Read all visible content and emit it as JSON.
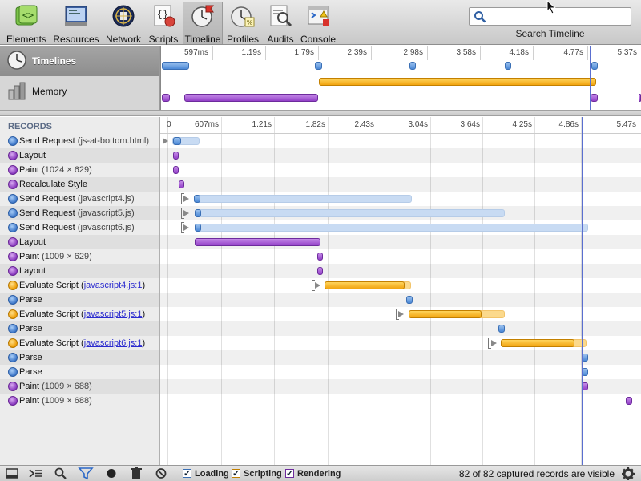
{
  "toolbar": {
    "tabs": [
      {
        "label": "Elements",
        "icon": "elements-icon"
      },
      {
        "label": "Resources",
        "icon": "resources-icon"
      },
      {
        "label": "Network",
        "icon": "network-icon"
      },
      {
        "label": "Scripts",
        "icon": "scripts-icon"
      },
      {
        "label": "Timeline",
        "icon": "timeline-icon",
        "active": true
      },
      {
        "label": "Profiles",
        "icon": "profiles-icon"
      },
      {
        "label": "Audits",
        "icon": "audits-icon"
      },
      {
        "label": "Console",
        "icon": "console-icon"
      }
    ],
    "search": {
      "value": "",
      "label": "Search Timeline"
    }
  },
  "overview": {
    "items": [
      {
        "label": "Timelines",
        "icon": "timelines-icon",
        "selected": true
      },
      {
        "label": "Memory",
        "icon": "memory-icon",
        "selected": false
      }
    ],
    "ticks": [
      "597ms",
      "1.19s",
      "1.79s",
      "2.39s",
      "2.98s",
      "3.58s",
      "4.18s",
      "4.77s",
      "5.37s"
    ]
  },
  "records": {
    "header": "RECORDS",
    "ticks": [
      "0",
      "607ms",
      "1.21s",
      "1.82s",
      "2.43s",
      "3.04s",
      "3.64s",
      "4.25s",
      "4.86s",
      "5.47s"
    ],
    "rows": [
      {
        "type": "blue",
        "name": "Send Request",
        "detail": "(js-at-bottom.html)"
      },
      {
        "type": "purple",
        "name": "Layout"
      },
      {
        "type": "purple",
        "name": "Paint",
        "detail": "(1024 × 629)"
      },
      {
        "type": "purple",
        "name": "Recalculate Style"
      },
      {
        "type": "blue",
        "name": "Send Request",
        "detail": "(javascript4.js)"
      },
      {
        "type": "blue",
        "name": "Send Request",
        "detail": "(javascript5.js)"
      },
      {
        "type": "blue",
        "name": "Send Request",
        "detail": "(javascript6.js)"
      },
      {
        "type": "purple",
        "name": "Layout"
      },
      {
        "type": "purple",
        "name": "Paint",
        "detail": "(1009 × 629)"
      },
      {
        "type": "purple",
        "name": "Layout"
      },
      {
        "type": "orange",
        "name": "Evaluate Script",
        "link": "javascript4.js:1"
      },
      {
        "type": "blue",
        "name": "Parse"
      },
      {
        "type": "orange",
        "name": "Evaluate Script",
        "link": "javascript5.js:1"
      },
      {
        "type": "blue",
        "name": "Parse"
      },
      {
        "type": "orange",
        "name": "Evaluate Script",
        "link": "javascript6.js:1"
      },
      {
        "type": "blue",
        "name": "Parse"
      },
      {
        "type": "blue",
        "name": "Parse"
      },
      {
        "type": "purple",
        "name": "Paint",
        "detail": "(1009 × 688)"
      },
      {
        "type": "purple",
        "name": "Paint",
        "detail": "(1009 × 688)"
      }
    ]
  },
  "statusbar": {
    "filters": [
      {
        "label": "Loading",
        "color": "#4b88d6",
        "checked": true
      },
      {
        "label": "Scripting",
        "color": "#f1a410",
        "checked": true
      },
      {
        "label": "Rendering",
        "color": "#9340c8",
        "checked": true
      }
    ],
    "status": "82 of 82 captured records are visible"
  },
  "colors": {
    "loading": "#4b88d6",
    "scripting": "#f1a410",
    "rendering": "#9340c8",
    "cursor_line": "#5a6fd0"
  }
}
